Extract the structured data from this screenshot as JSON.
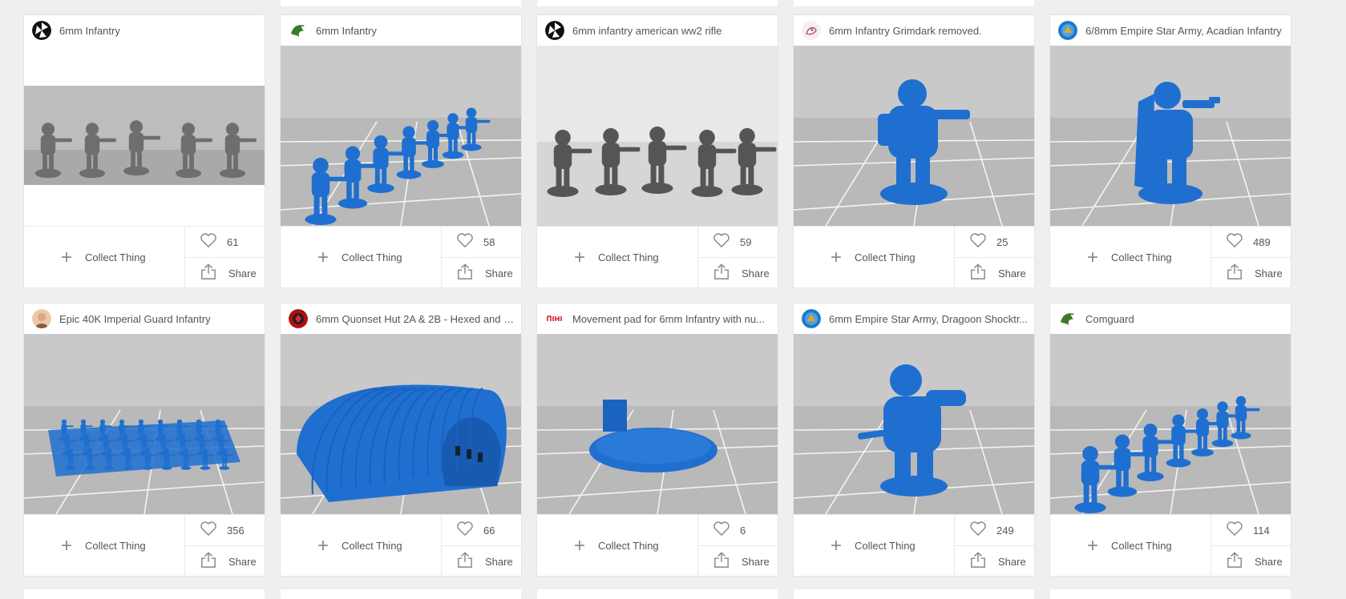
{
  "collect_label": "Collect Thing",
  "share_label": "Share",
  "cards": [
    {
      "title": "6mm Infantry",
      "likes": "61",
      "avatar": "bw-logo-icon",
      "thumb": "grey-infantry-photo"
    },
    {
      "title": "6mm Infantry",
      "likes": "58",
      "avatar": "dragon-icon",
      "thumb": "blue-infantry-line"
    },
    {
      "title": "6mm infantry american ww2 rifle",
      "likes": "59",
      "avatar": "bw-logo-icon",
      "thumb": "grey-infantry-render"
    },
    {
      "title": "6mm Infantry Grimdark removed.",
      "likes": "25",
      "avatar": "sketch-avatar-icon",
      "thumb": "blue-trooper"
    },
    {
      "title": "6/8mm Empire Star Army, Acadian Infantry",
      "likes": "489",
      "avatar": "blue-emblem-icon",
      "thumb": "blue-trooper-cape"
    },
    {
      "title": "Epic 40K Imperial Guard Infantry",
      "likes": "356",
      "avatar": "face-avatar-icon",
      "thumb": "blue-infantry-grid"
    },
    {
      "title": "6mm Quonset Hut 2A & 2B - Hexed and H...",
      "likes": "66",
      "avatar": "red-emblem-icon",
      "thumb": "blue-quonset-hut"
    },
    {
      "title": "Movement pad for 6mm Infantry with nu...",
      "likes": "6",
      "avatar": "red-logo-icon",
      "thumb": "blue-hex-pad"
    },
    {
      "title": "6mm Empire Star Army, Dragoon Shocktr...",
      "likes": "249",
      "avatar": "blue-emblem-icon",
      "thumb": "blue-heavy-trooper"
    },
    {
      "title": "Comguard",
      "likes": "114",
      "avatar": "dragon-icon",
      "thumb": "blue-infantry-line"
    }
  ],
  "colors": {
    "model_blue": "#1f6fd0",
    "floor_grey": "#a8a8a8",
    "card_bg": "#ffffff",
    "page_bg": "#efefef"
  }
}
